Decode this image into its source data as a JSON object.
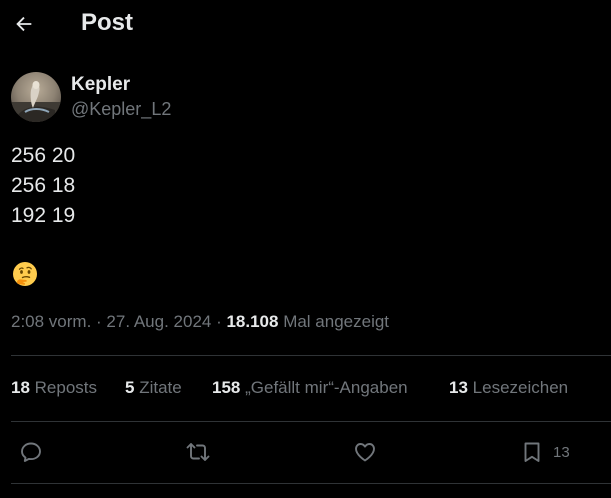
{
  "header": {
    "title": "Post"
  },
  "author": {
    "name": "Kepler",
    "handle": "@Kepler_L2"
  },
  "post": {
    "lines": [
      "256 20",
      "256 18",
      "192 19"
    ],
    "emoji": "thinking-face"
  },
  "meta": {
    "time": "2:08 vorm.",
    "sep1": " · ",
    "date": "27. Aug. 2024",
    "sep2": " · ",
    "views_count": "18.108",
    "views_label": " Mal angezeigt"
  },
  "stats": {
    "reposts_count": "18",
    "reposts_label": "Reposts",
    "quotes_count": "5",
    "quotes_label": "Zitate",
    "likes_count": "158",
    "likes_label": "„Gefällt mir“-Angaben",
    "bookmarks_count": "13",
    "bookmarks_label": "Lesezeichen"
  },
  "actions": {
    "bookmark_count": "13"
  },
  "colors": {
    "background": "#000000",
    "text_primary": "#e7e9ea",
    "text_secondary": "#71767b",
    "divider": "#2f3336"
  }
}
